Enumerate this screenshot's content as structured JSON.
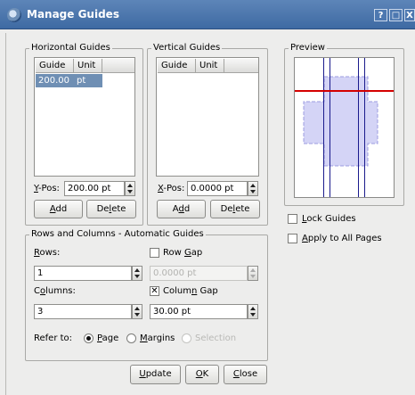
{
  "window": {
    "title": "Manage Guides",
    "buttons": {
      "help": "?",
      "maximize": "□",
      "close": "X"
    }
  },
  "horizontal": {
    "legend": "Horizontal Guides",
    "columns": [
      "Guide",
      "Unit"
    ],
    "rows": [
      {
        "guide": "200.00",
        "unit": "pt",
        "selected": true
      }
    ],
    "pos_label_key": "Y",
    "pos_label_rest": "-Pos:",
    "pos_value": "200.00 pt",
    "add": {
      "pre": "",
      "key": "A",
      "post": "dd"
    },
    "delete": {
      "pre": "De",
      "key": "l",
      "post": "ete"
    }
  },
  "vertical": {
    "legend": "Vertical Guides",
    "columns": [
      "Guide",
      "Unit"
    ],
    "rows": [],
    "pos_label_key": "X",
    "pos_label_rest": "-Pos:",
    "pos_value": "0.0000 pt",
    "add": {
      "pre": "A",
      "key": "d",
      "post": "d"
    },
    "delete": {
      "pre": "De",
      "key": "l",
      "post": "ete"
    }
  },
  "preview": {
    "legend": "Preview",
    "colors": {
      "guide_horizontal": "#d40000",
      "guide_vertical": "#1a1a8c",
      "shape": "#d4d4f6",
      "shape_border": "#9c9ce0"
    }
  },
  "options": {
    "lock_guides": {
      "key": "L",
      "rest": "ock Guides",
      "checked": false
    },
    "apply_all": {
      "key": "A",
      "rest": "pply to All Pages",
      "checked": false
    }
  },
  "auto": {
    "legend": "Rows and Columns - Automatic Guides",
    "rows_label": {
      "key": "R",
      "rest": "ows:"
    },
    "rows_value": "1",
    "row_gap": {
      "pre": "Row ",
      "key": "G",
      "post": "ap",
      "checked": false,
      "value": "0.0000 pt"
    },
    "columns_label": {
      "pre": "C",
      "key": "o",
      "post": "lumns:"
    },
    "columns_value": "3",
    "column_gap": {
      "pre": "Colum",
      "key": "n",
      "post": " Gap",
      "checked": true,
      "mark": "✕",
      "value": "30.00 pt"
    },
    "refer_to": "Refer to:",
    "refer_options": [
      {
        "pre": "",
        "key": "P",
        "post": "age",
        "selected": true,
        "enabled": true
      },
      {
        "pre": "",
        "key": "M",
        "post": "argins",
        "selected": false,
        "enabled": true
      },
      {
        "pre": "Selection",
        "key": "",
        "post": "",
        "selected": false,
        "enabled": false
      }
    ]
  },
  "footer": {
    "update": {
      "key": "U",
      "rest": "pdate"
    },
    "ok": {
      "key": "O",
      "rest": "K"
    },
    "close": {
      "key": "C",
      "rest": "lose"
    }
  }
}
